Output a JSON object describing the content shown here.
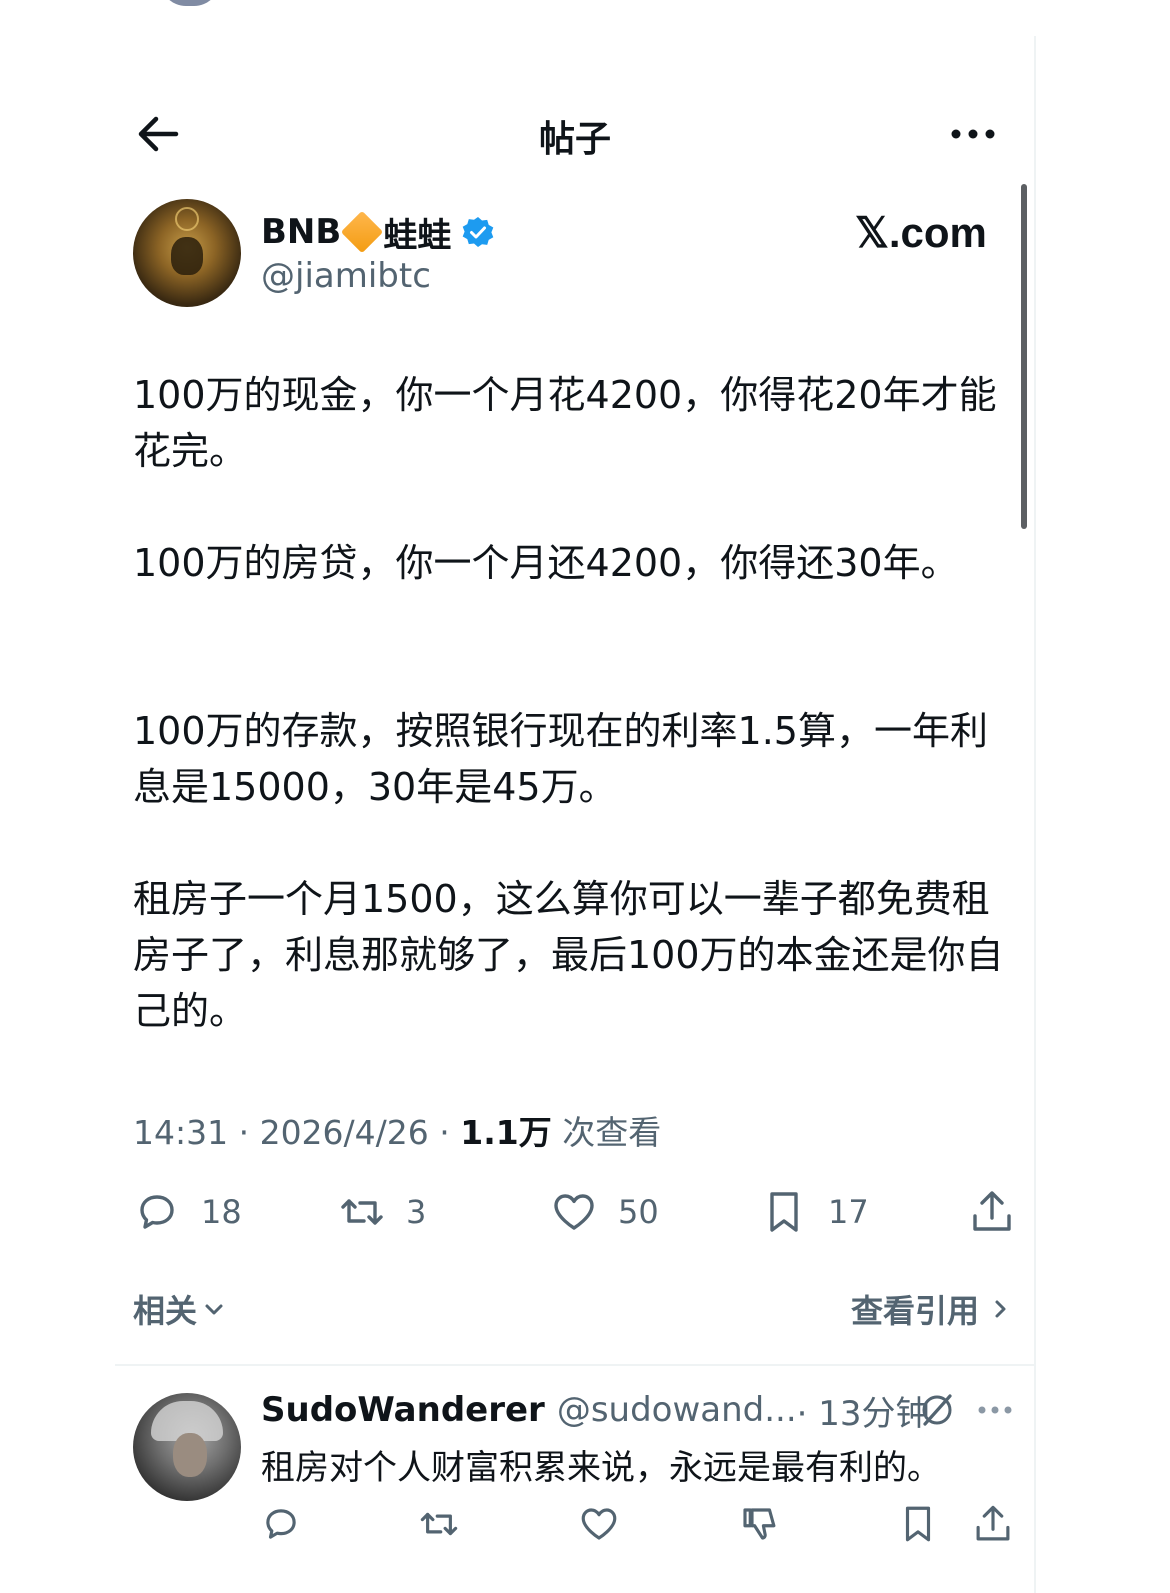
{
  "header": {
    "title": "帖子"
  },
  "author": {
    "name_prefix": "BNB",
    "name_suffix": "蛙蛙",
    "handle": "@jiamibtc",
    "watermark": "𝕏.com"
  },
  "post": {
    "paragraphs": [
      "100万的现金，你一个月花4200，你得花20年才能花完。",
      "100万的房贷，你一个月还4200，你得还30年。",
      "100万的存款，按照银行现在的利率1.5算，一年利息是15000，30年是45万。",
      "租房子一个月1500，这么算你可以一辈子都免费租房子了，利息那就够了，最后100万的本金还是你自己的。"
    ],
    "time": "14:31 · 2026/4/26 · ",
    "views_count": "1.1万",
    "views_label": " 次查看"
  },
  "actions": {
    "replies": "18",
    "reposts": "3",
    "likes": "50",
    "bookmarks": "17"
  },
  "related": {
    "label": "相关",
    "quotes_label": "查看引用"
  },
  "reply": {
    "name": "SudoWanderer",
    "handle": "@sudowand...",
    "time": " · 13分钟",
    "text": "租房对个人财富积累来说，永远是最有利的。"
  },
  "colors": {
    "text": "#0f1419",
    "secondary": "#536471",
    "verified": "#1d9bf0",
    "divider": "#eff3f4"
  }
}
